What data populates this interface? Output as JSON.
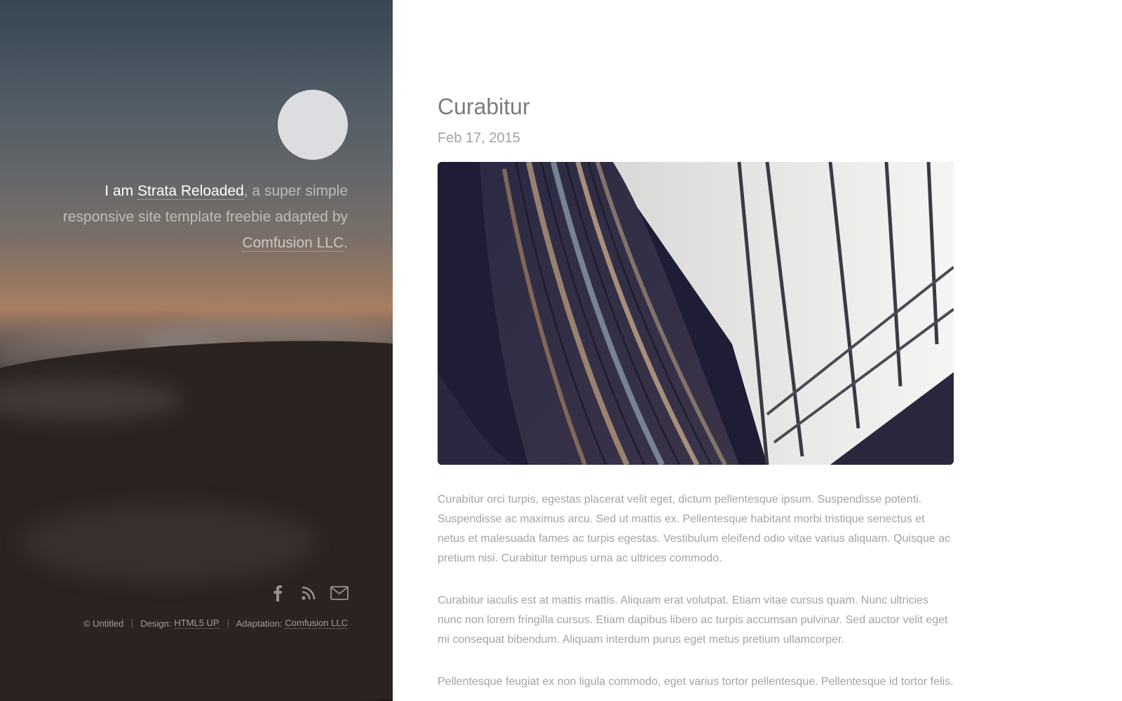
{
  "sidebar": {
    "intro": {
      "prefix": "I am ",
      "name_link": "Strata Reloaded",
      "middle": ", a super simple responsive site template freebie adapted by ",
      "company_link": "Comfusion LLC",
      "suffix": "."
    },
    "social": [
      {
        "icon": "facebook-icon",
        "glyph": "f"
      },
      {
        "icon": "rss-icon"
      },
      {
        "icon": "mail-icon"
      }
    ],
    "footer": {
      "copyright": "© Untitled",
      "design_label": "Design:",
      "design_link": "HTML5 UP",
      "adaptation_label": "Adaptation:",
      "adaptation_link": "Comfusion LLC"
    }
  },
  "post": {
    "title": "Curabitur",
    "date": "Feb 17, 2015",
    "paragraphs": [
      "Curabitur orci turpis, egestas placerat velit eget, dictum pellentesque ipsum. Suspendisse potenti. Suspendisse ac maximus arcu. Sed ut mattis ex. Pellentesque habitant morbi tristique senectus et netus et malesuada fames ac turpis egestas. Vestibulum eleifend odio vitae varius aliquam. Quisque ac pretium nisi. Curabitur tempus urna ac ultrices commodo.",
      "Curabitur iaculis est at mattis mattis. Aliquam erat volutpat. Etiam vitae cursus quam. Nunc ultricies nunc non lorem fringilla cursus. Etiam dapibus libero ac turpis accumsan pulvinar. Sed auctor velit eget mi consequat bibendum. Aliquam interdum purus eget metus pretium ullamcorper.",
      "Pellentesque feugiat ex non ligula commodo, eget varius tortor pellentesque. Pellentesque id tortor felis."
    ]
  },
  "colors": {
    "body_text": "#a3a3a3",
    "title_text": "#7c7c7c",
    "sidebar_accent": "#ffffff"
  }
}
